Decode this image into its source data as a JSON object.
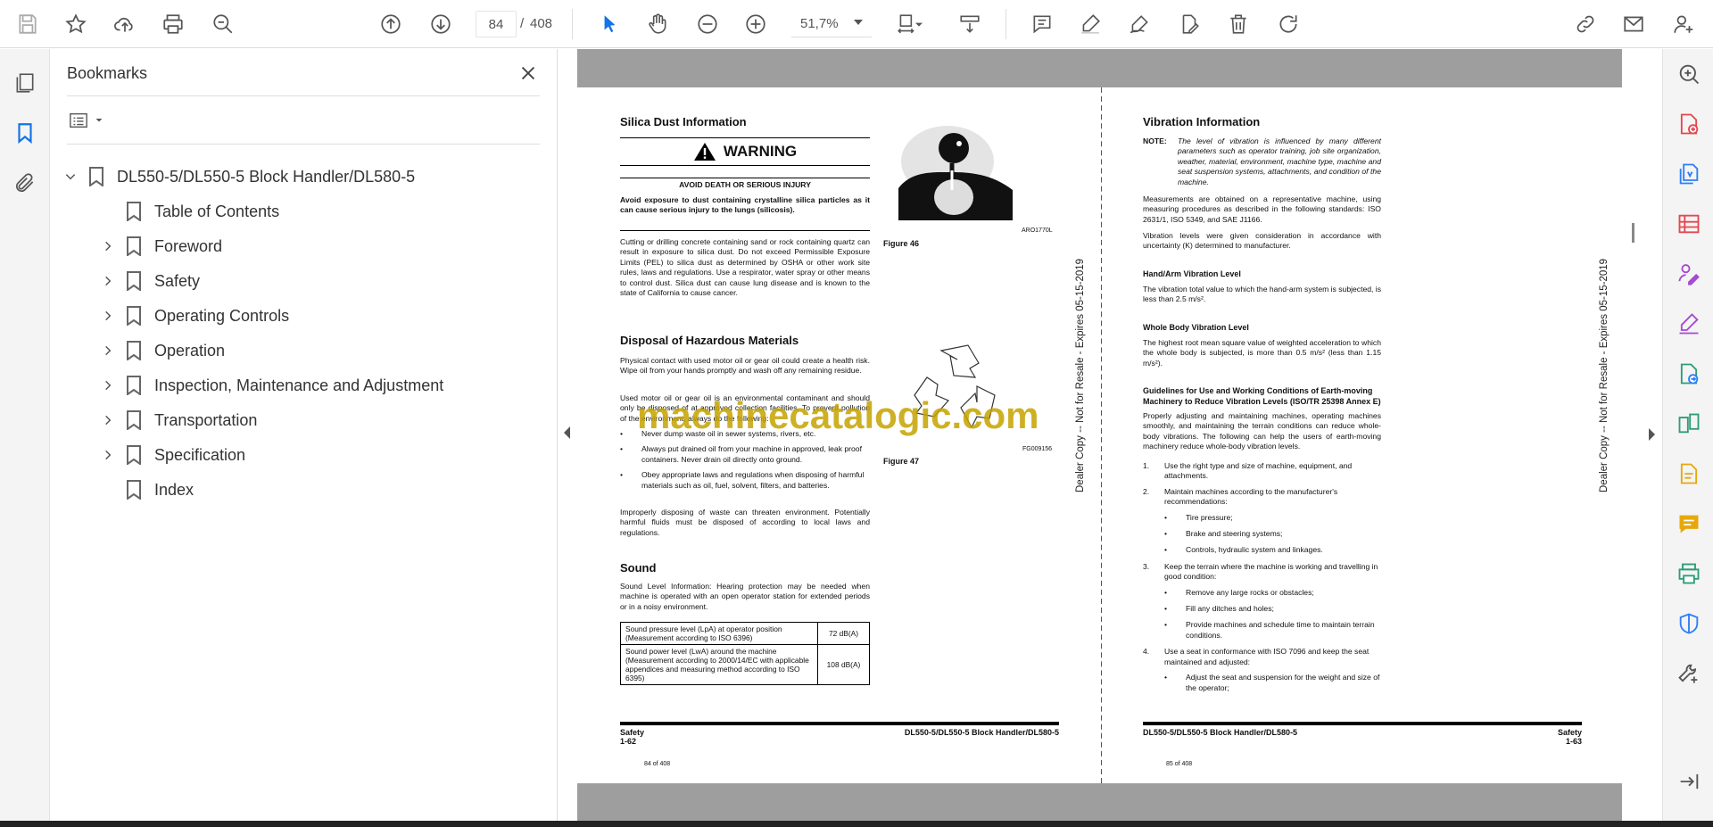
{
  "toolbar": {
    "page_current": "84",
    "page_separator": "/",
    "page_total": "408",
    "zoom": "51,7%"
  },
  "bookmarks": {
    "title": "Bookmarks",
    "root": "DL550-5/DL550-5 Block Handler/DL580-5",
    "items": [
      {
        "label": "Table of Contents",
        "expandable": false
      },
      {
        "label": "Foreword",
        "expandable": true
      },
      {
        "label": "Safety",
        "expandable": true
      },
      {
        "label": "Operating Controls",
        "expandable": true
      },
      {
        "label": "Operation",
        "expandable": true
      },
      {
        "label": "Inspection, Maintenance and Adjustment",
        "expandable": true
      },
      {
        "label": "Transportation",
        "expandable": true
      },
      {
        "label": "Specification",
        "expandable": true
      },
      {
        "label": "Index",
        "expandable": false
      }
    ]
  },
  "left_page": {
    "silica_title": "Silica Dust Information",
    "warning_label": "WARNING",
    "warning_sub": "AVOID DEATH OR SERIOUS INJURY",
    "warning_body": "Avoid exposure to dust containing crystalline silica particles as it can cause serious injury to the lungs (silicosis).",
    "silica_text": "Cutting or drilling concrete containing sand or rock containing quartz can result in exposure to silica dust. Do not exceed Permissible Exposure Limits (PEL) to silica dust as determined by OSHA or other work site rules, laws and regulations. Use a respirator, water spray or other means to control dust. Silica dust can cause lung disease and is known to the state of California to cause cancer.",
    "fig46_code": "ARO1770L",
    "fig46_caption": "Figure 46",
    "disposal_title": "Disposal of Hazardous Materials",
    "disposal_p1": "Physical contact with used motor oil or gear oil could create a health risk. Wipe oil from your hands promptly and wash off any remaining residue.",
    "disposal_p2": "Used motor oil or gear oil is an environmental contaminant and should only be disposed of at approved collection facilities. To prevent pollution of the environment, always do the following:",
    "disposal_bullets": [
      "Never dump waste oil in sewer systems, rivers, etc.",
      "Always put drained oil from your machine in approved, leak proof containers. Never drain oil directly onto ground.",
      "Obey appropriate laws and regulations when disposing of harmful materials such as oil, fuel, solvent, filters, and batteries."
    ],
    "disposal_p3": "Improperly disposing of waste can threaten environment. Potentially harmful fluids must be disposed of according to local laws and regulations.",
    "fig47_code": "FG009156",
    "fig47_caption": "Figure 47",
    "sound_title": "Sound",
    "sound_text": "Sound Level Information: Hearing protection may be needed when machine is operated with an open operator station for extended periods or in a noisy environment.",
    "sound_table": [
      {
        "desc": "Sound pressure level (LpA) at operator position (Measurement according to ISO 6396)",
        "value": "72 dB(A)"
      },
      {
        "desc": "Sound power level (LwA) around the machine (Measurement according to 2000/14/EC with applicable appendices and measuring method according to ISO 6395)",
        "value": "108 dB(A)"
      }
    ],
    "footer_left": "Safety",
    "footer_left_page": "1-62",
    "footer_right": "DL550-5/DL550-5 Block Handler/DL580-5",
    "page_of": "84 of 408",
    "side_stamp": "Dealer Copy -- Not for Resale - Expires 05-15-2019"
  },
  "right_page": {
    "vib_title": "Vibration Information",
    "note_label": "NOTE:",
    "note_text": "The level of vibration is influenced by many different parameters such as operator training, job site organization, weather, material, environment, machine type, machine and seat suspension systems, attachments, and condition of the machine.",
    "p1": "Measurements are obtained on a representative machine, using measuring procedures as described in the following standards: ISO 2631/1, ISO 5349, and SAE J1166.",
    "p2": "Vibration levels were given consideration in accordance with uncertainty (K) determined to manufacturer.",
    "hand_title": "Hand/Arm Vibration Level",
    "hand_text": "The vibration total value to which the hand-arm system is subjected, is less than 2.5 m/s².",
    "body_title": "Whole Body Vibration Level",
    "body_text": "The highest root mean square value of weighted acceleration to which the whole body is subjected, is more than 0.5 m/s² (less than 1.15 m/s²).",
    "guide_title": "Guidelines for Use and Working Conditions of Earth-moving Machinery to Reduce Vibration Levels (ISO/TR 25398 Annex E)",
    "guide_text": "Properly adjusting and maintaining machines, operating machines smoothly, and maintaining the terrain conditions can reduce whole-body vibrations. The following can help the users of earth-moving machinery reduce whole-body vibration levels.",
    "list": [
      {
        "n": "1.",
        "text": "Use the right type and size of machine, equipment, and attachments.",
        "subs": []
      },
      {
        "n": "2.",
        "text": "Maintain machines according to the manufacturer's recommendations:",
        "subs": [
          "Tire pressure;",
          "Brake and steering systems;",
          "Controls, hydraulic system and linkages."
        ]
      },
      {
        "n": "3.",
        "text": "Keep the terrain where the machine is working and travelling in good condition:",
        "subs": [
          "Remove any large rocks or obstacles;",
          "Fill any ditches and holes;",
          "Provide machines and schedule time to maintain terrain conditions."
        ]
      },
      {
        "n": "4.",
        "text": "Use a seat in conformance with ISO 7096 and keep the seat maintained and adjusted:",
        "subs": [
          "Adjust the seat and suspension for the weight and size of the operator;"
        ]
      }
    ],
    "footer_left": "DL550-5/DL550-5 Block Handler/DL580-5",
    "footer_right": "Safety",
    "footer_right_page": "1-63",
    "page_of": "85 of 408",
    "side_stamp": "Dealer Copy -- Not for Resale - Expires 05-15-2019"
  },
  "watermark": "machinecatalogic.com"
}
